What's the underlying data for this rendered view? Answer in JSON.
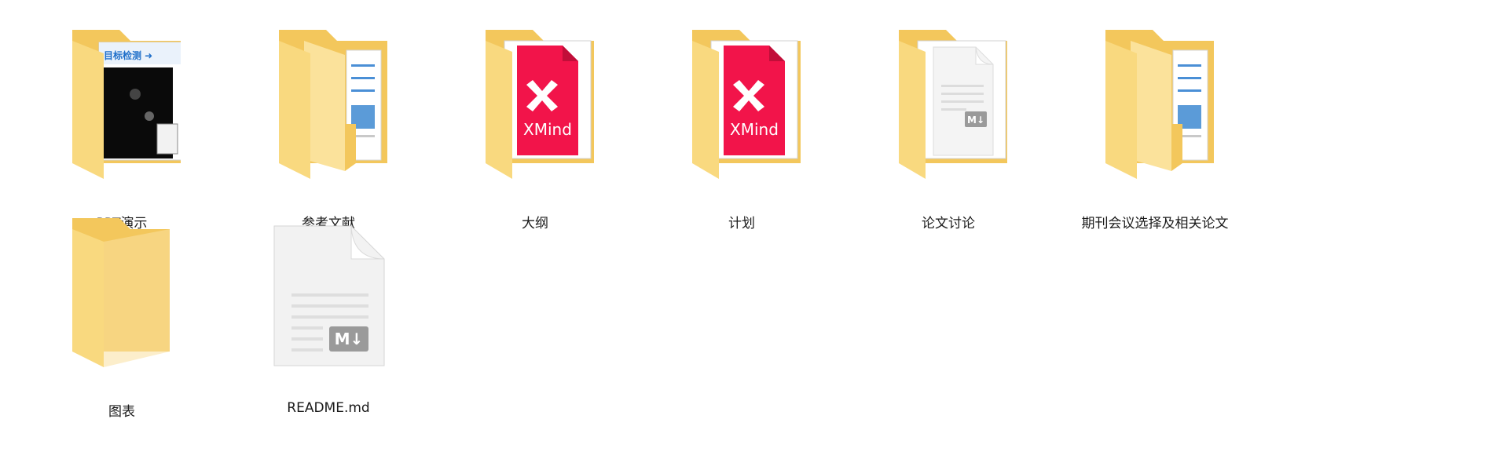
{
  "items": [
    {
      "name": "PPT演示",
      "type": "folder",
      "preview": "ppt-slide",
      "preview_text": "目标检测"
    },
    {
      "name": "参考文献",
      "type": "folder",
      "preview": "documents"
    },
    {
      "name": "大纲",
      "type": "folder",
      "preview": "xmind",
      "preview_text": "XMind"
    },
    {
      "name": "计划",
      "type": "folder",
      "preview": "xmind",
      "preview_text": "XMind"
    },
    {
      "name": "论文讨论",
      "type": "folder",
      "preview": "markdown-file"
    },
    {
      "name": "期刊会议选择及相关论文",
      "type": "folder",
      "preview": "documents"
    },
    {
      "name": "图表",
      "type": "folder",
      "preview": "empty"
    },
    {
      "name": "README.md",
      "type": "file",
      "preview": "markdown-file"
    }
  ],
  "colors": {
    "folder_back": "#f3c75c",
    "folder_front": "#f9d97f",
    "folder_front_light": "#fde9a8",
    "xmind_red": "#f2144a",
    "md_badge": "#9a9a9a"
  }
}
